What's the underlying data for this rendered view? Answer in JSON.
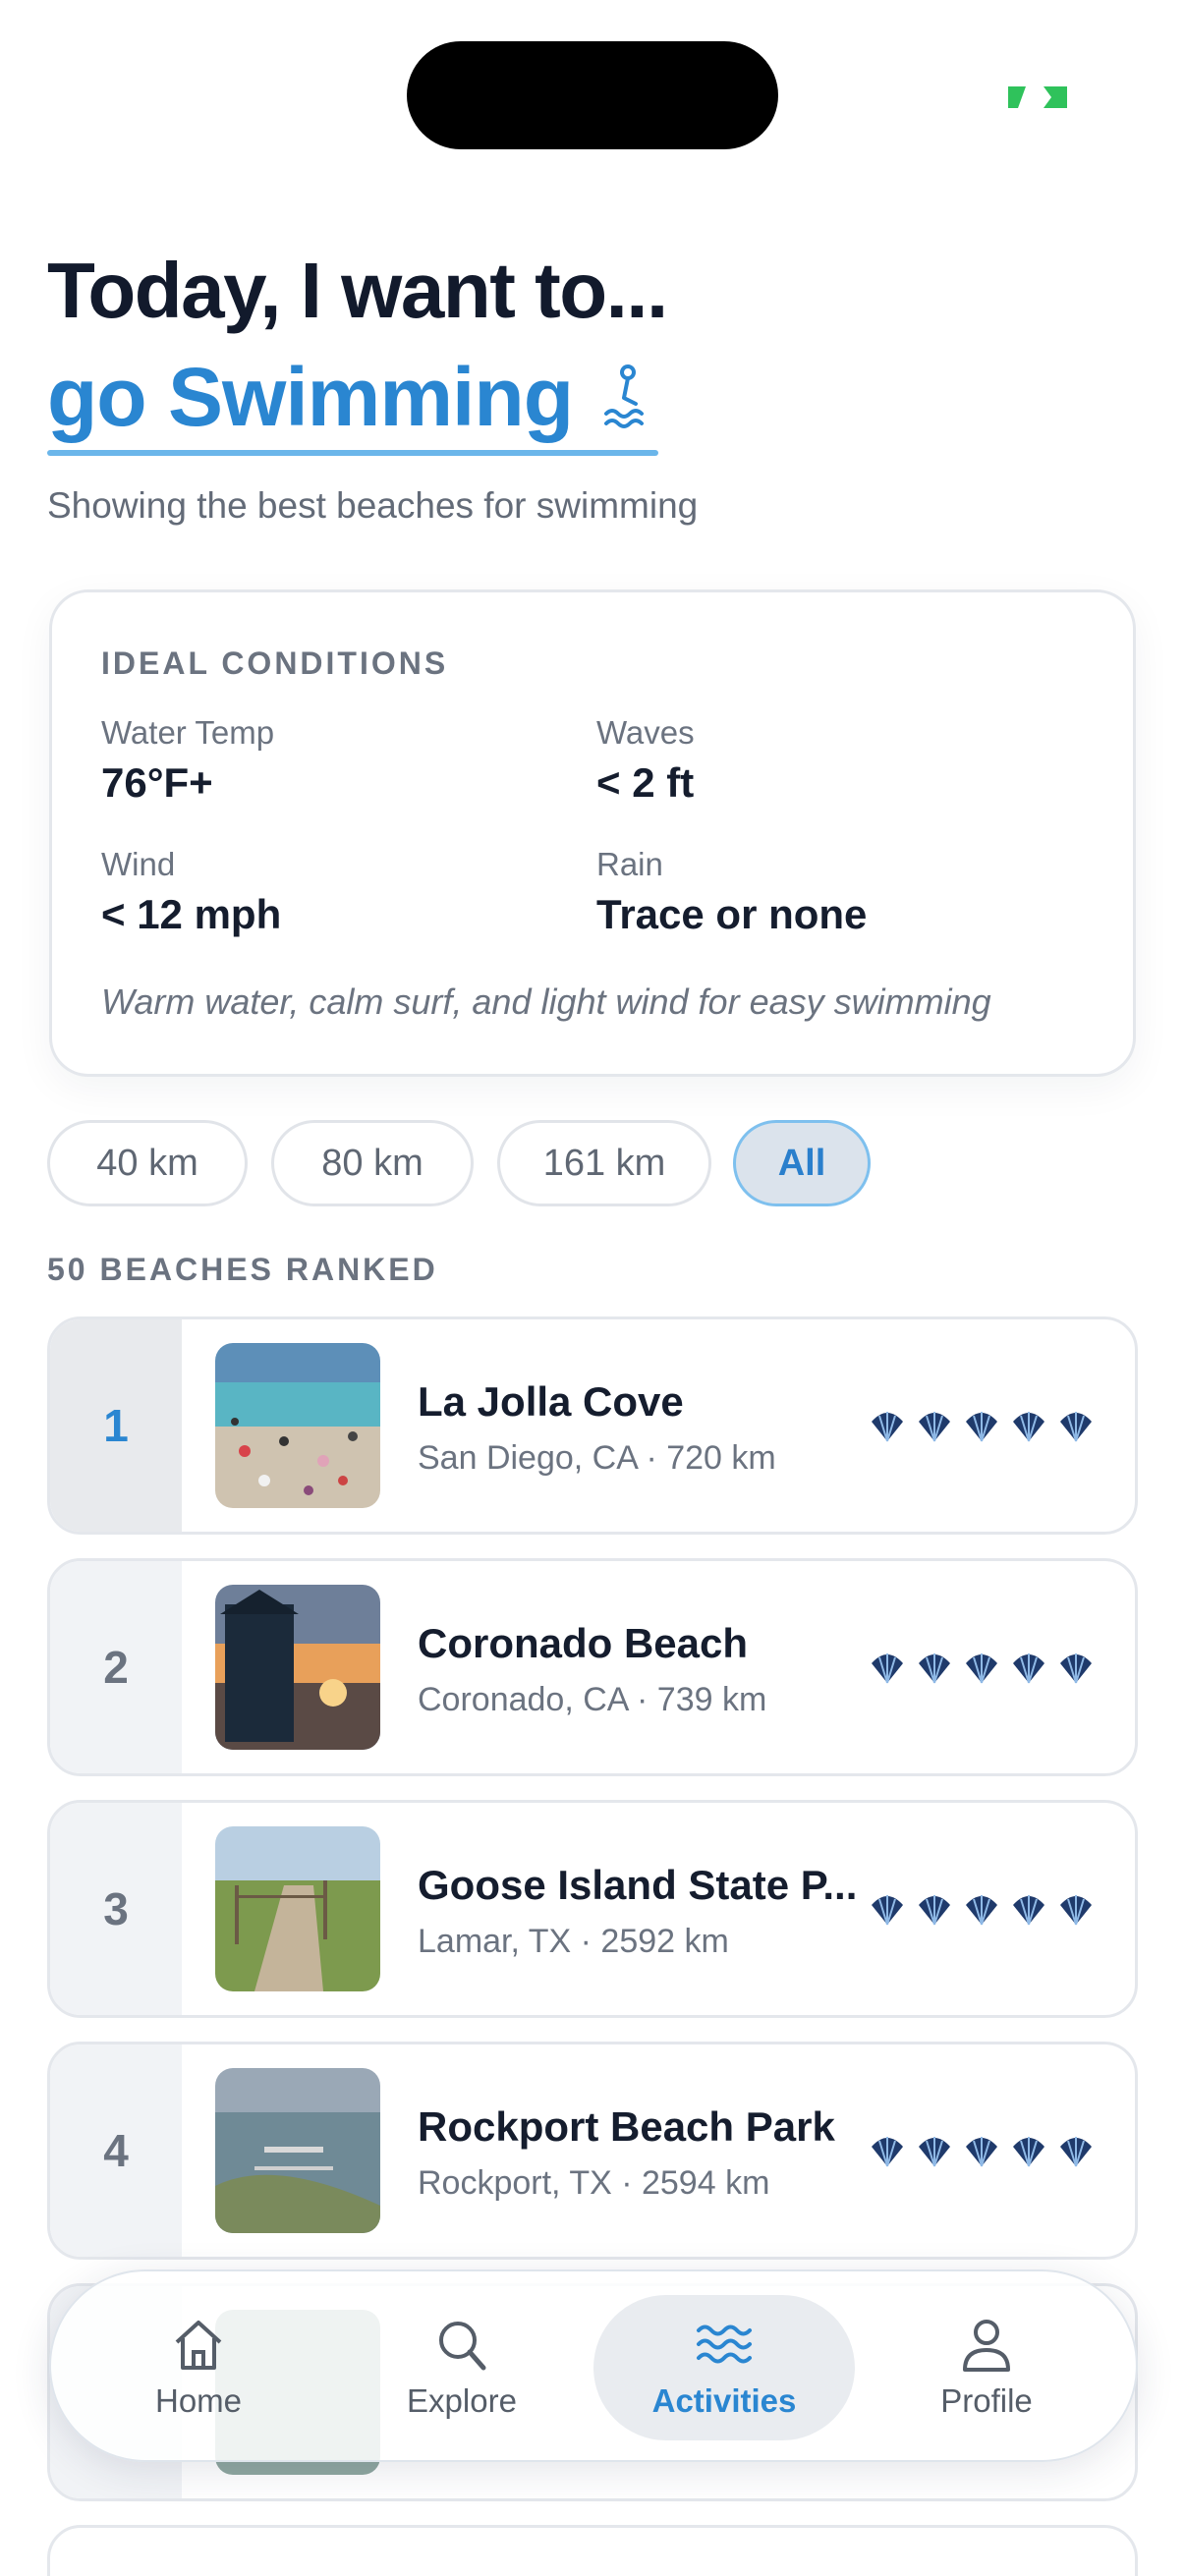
{
  "header": {
    "headline": "Today, I want to...",
    "activity": "go Swimming",
    "activity_icon": "swimmer-icon",
    "subtitle": "Showing the best beaches for swimming"
  },
  "conditions": {
    "title": "IDEAL CONDITIONS",
    "items": [
      {
        "label": "Water Temp",
        "value": "76°F+"
      },
      {
        "label": "Waves",
        "value": "< 2 ft"
      },
      {
        "label": "Wind",
        "value": "< 12 mph"
      },
      {
        "label": "Rain",
        "value": "Trace or none"
      }
    ],
    "note": "Warm water, calm surf, and light wind for easy swimming"
  },
  "filters": {
    "chips": [
      "40 km",
      "80 km",
      "161 km",
      "All"
    ],
    "selected": "All"
  },
  "ranked_label": "50 BEACHES RANKED",
  "beaches": [
    {
      "rank": "1",
      "name": "La Jolla Cove",
      "meta": "San Diego, CA · 720 km",
      "shells": 5
    },
    {
      "rank": "2",
      "name": "Coronado Beach",
      "meta": "Coronado, CA · 739 km",
      "shells": 5
    },
    {
      "rank": "3",
      "name": "Goose Island State P...",
      "meta": "Lamar, TX · 2592 km",
      "shells": 5
    },
    {
      "rank": "4",
      "name": "Rockport Beach Park",
      "meta": "Rockport, TX · 2594 km",
      "shells": 5
    }
  ],
  "tabs": [
    {
      "label": "Home",
      "icon": "home-icon"
    },
    {
      "label": "Explore",
      "icon": "search-icon"
    },
    {
      "label": "Activities",
      "icon": "waves-icon"
    },
    {
      "label": "Profile",
      "icon": "person-icon"
    }
  ],
  "active_tab": "Activities",
  "colors": {
    "accent": "#2a86d1",
    "text": "#121a2c",
    "muted": "#6b7380",
    "battery": "#2fc25b"
  }
}
